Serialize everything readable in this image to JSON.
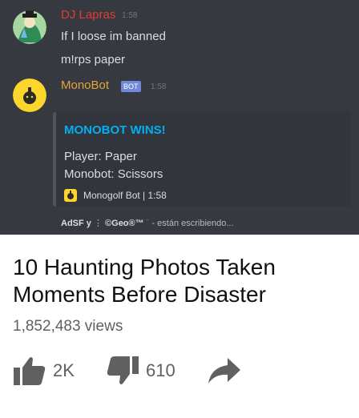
{
  "chat": {
    "messages": [
      {
        "author": "DJ Lapras",
        "author_color": "#e53935",
        "time": "1:58",
        "lines": [
          "If I loose im banned",
          "m!rps paper"
        ],
        "avatar": "green-character-avatar"
      },
      {
        "author": "MonoBot",
        "author_color": "#e6a23c",
        "bot_tag": "BOT",
        "time": "1:58",
        "avatar": "monobot-avatar"
      }
    ],
    "embed": {
      "title": "MONOBOT WINS!",
      "lines": [
        "Player: Paper",
        "Monobot: Scissors"
      ],
      "footer": "Monogolf Bot | 1:58"
    },
    "typing": {
      "users": "AdSF y",
      "middle": "©Geo®™",
      "suffix": "- están escribiendo..."
    }
  },
  "video": {
    "title": "10 Haunting Photos Taken Moments Before Disaster",
    "views": "1,852,483 views",
    "likes": "2K",
    "dislikes": "610",
    "share_icon": "share-arrow-icon"
  }
}
